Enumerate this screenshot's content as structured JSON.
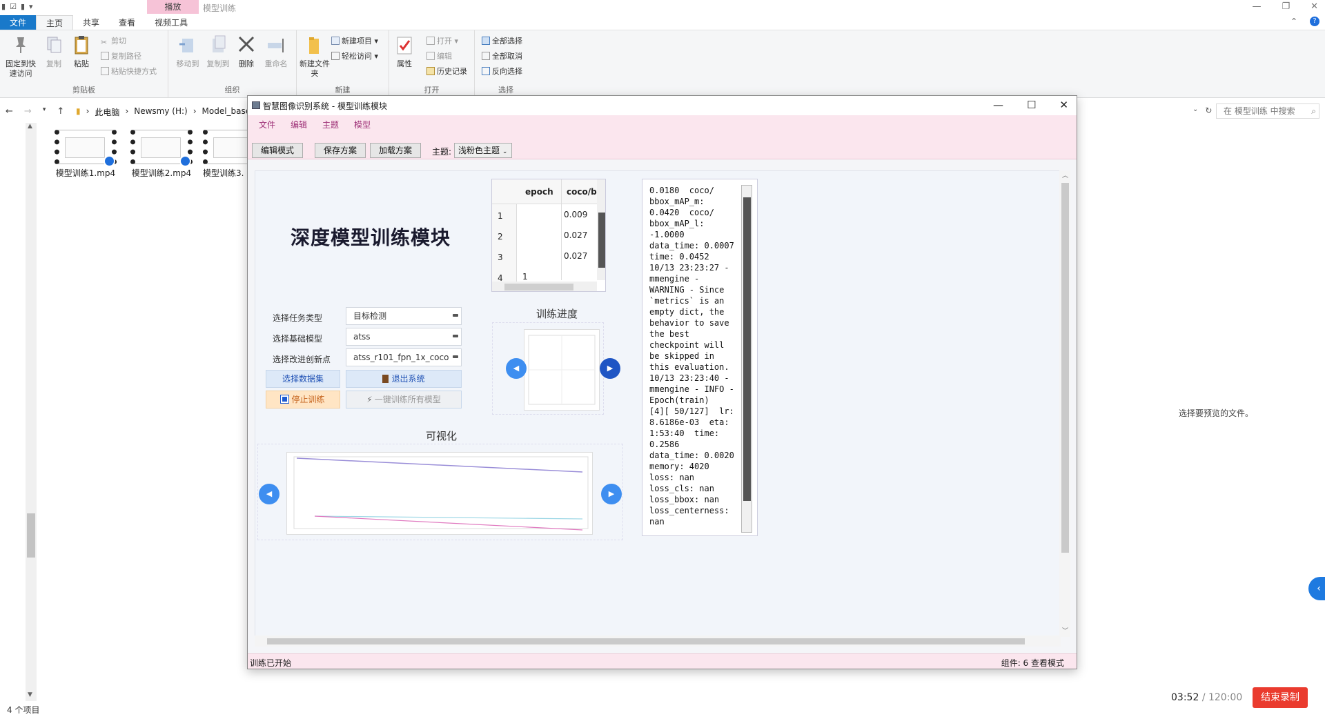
{
  "explorer": {
    "context_tab": "播放",
    "title": "模型训练",
    "tabs": [
      "文件",
      "主页",
      "共享",
      "查看",
      "视频工具"
    ],
    "ribbon": {
      "clipboard": {
        "pin": "固定到快速访问",
        "copy": "复制",
        "paste": "粘贴",
        "cut": "剪切",
        "copy_path": "复制路径",
        "paste_shortcut": "粘贴快捷方式",
        "label": "剪贴板"
      },
      "organize": {
        "move_to": "移动到",
        "copy_to": "复制到",
        "delete": "删除",
        "rename": "重命名",
        "label": "组织"
      },
      "new": {
        "new_folder": "新建文件夹",
        "new_item": "新建项目",
        "easy_access": "轻松访问",
        "label": "新建"
      },
      "open": {
        "properties": "属性",
        "open": "打开",
        "edit": "编辑",
        "history": "历史记录",
        "label": "打开"
      },
      "select": {
        "select_all": "全部选择",
        "select_none": "全部取消",
        "invert": "反向选择",
        "label": "选择"
      }
    },
    "breadcrumbs": [
      "此电脑",
      "Newsmy (H:)",
      "Model_base"
    ],
    "search_placeholder": "在 模型训练 中搜索",
    "files": [
      "模型训练1.mp4",
      "模型训练2.mp4",
      "模型训练3."
    ],
    "preview_text": "选择要预览的文件。",
    "status": "4 个项目"
  },
  "recorder": {
    "elapsed": "03:52",
    "total": "/ 120:00",
    "stop_label": "结束录制"
  },
  "app": {
    "title": "智慧图像识别系统 - 模型训练模块",
    "menu": [
      "文件",
      "编辑",
      "主题",
      "模型"
    ],
    "toolbar": {
      "edit_mode": "编辑模式",
      "save_plan": "保存方案",
      "load_plan": "加载方案",
      "theme_label": "主题:",
      "theme_value": "浅粉色主题"
    },
    "heading": "深度模型训练模块",
    "form": {
      "task_label": "选择任务类型",
      "task_value": "目标检测",
      "base_label": "选择基础模型",
      "base_value": "atss",
      "ckpt_label": "选择改进创新点",
      "ckpt_value": "atss_r101_fpn_1x_coco"
    },
    "buttons": {
      "dataset": "选择数据集",
      "exit": "退出系统",
      "stop": "停止训练",
      "train_all": "一键训练所有模型"
    },
    "table": {
      "headers": [
        "epoch",
        "coco/bbox_m"
      ],
      "rows": [
        [
          "1",
          "",
          "0.009"
        ],
        [
          "2",
          "",
          "0.027"
        ],
        [
          "3",
          "",
          "0.027"
        ],
        [
          "4",
          "1",
          ""
        ]
      ]
    },
    "progress_title": "训练进度",
    "viz_title": "可视化",
    "log": "0.0180  coco/\nbbox_mAP_m:\n0.0420  coco/\nbbox_mAP_l:\n-1.0000\ndata_time: 0.0007\ntime: 0.0452\n10/13 23:23:27 -\nmmengine -\nWARNING - Since\n`metrics` is an\nempty dict, the\nbehavior to save\nthe best\ncheckpoint will\nbe skipped in\nthis evaluation.\n10/13 23:23:40 -\nmmengine - INFO -\nEpoch(train)\n[4][ 50/127]  lr:\n8.6186e-03  eta:\n1:53:40  time:\n0.2586\ndata_time: 0.0020\nmemory: 4020\nloss: nan\nloss_cls: nan\nloss_bbox: nan\nloss_centerness:\nnan",
    "status_left": "训练已开始",
    "status_right": "组件: 6  查看模式"
  }
}
